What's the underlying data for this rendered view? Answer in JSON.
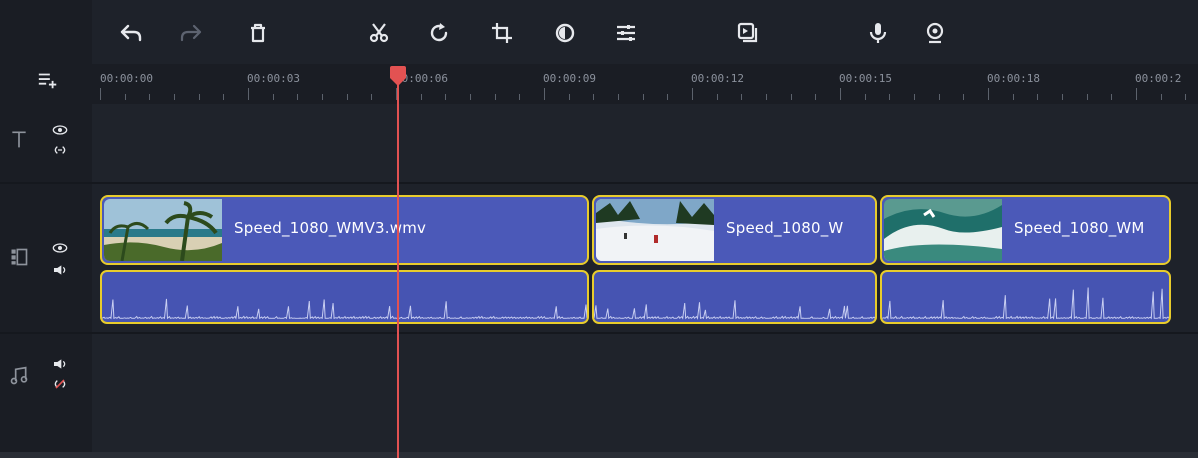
{
  "toolbar": {
    "icons": [
      "undo-icon",
      "redo-icon",
      "delete-icon",
      "cut-icon",
      "rotate-icon",
      "crop-icon",
      "color-adjust-icon",
      "clip-properties-icon",
      "overlay-icon",
      "microphone-icon",
      "webcam-icon"
    ]
  },
  "ruler": {
    "ticks": [
      "00:00:00",
      "00:00:03",
      "00:00:06",
      "00:00:09",
      "00:00:12",
      "00:00:15",
      "00:00:18",
      "00:00:2"
    ]
  },
  "tracks": {
    "title_track": {
      "icon": "title-track-icon"
    },
    "video_track": {
      "icon": "video-track-icon"
    },
    "audio_track": {
      "icon": "music-track-icon"
    }
  },
  "clips": [
    {
      "name": "Speed_1080_WMV3.wmv",
      "thumb": "palm-beach"
    },
    {
      "name": "Speed_1080_W",
      "thumb": "ski-slope"
    },
    {
      "name": "Speed_1080_WM",
      "thumb": "ocean-wave"
    }
  ],
  "playhead": {
    "time_label": "00:00:06"
  },
  "colors": {
    "clip_fill": "#4b59b8",
    "clip_border": "#e8cc2c",
    "playhead": "#e25252",
    "background": "#1e222a"
  }
}
